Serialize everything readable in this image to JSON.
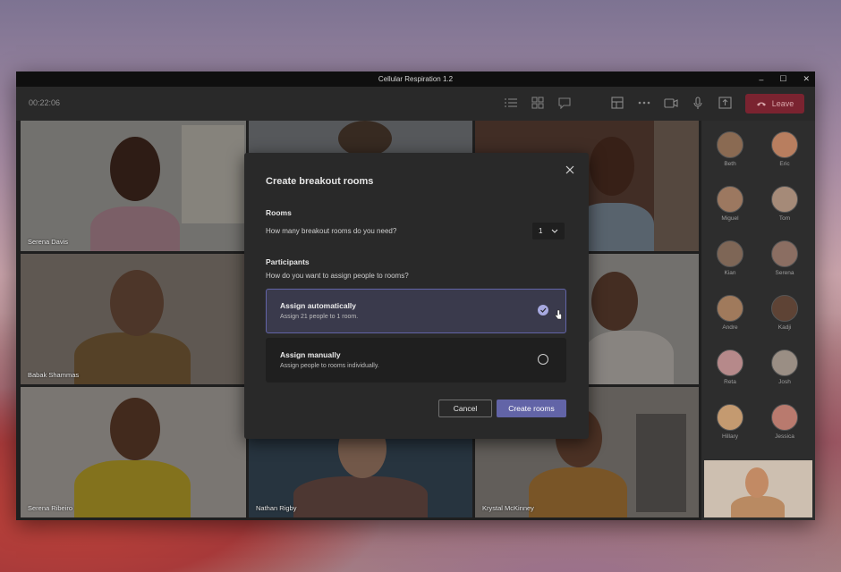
{
  "window": {
    "title": "Cellular Respiration 1.2",
    "controls": [
      "–",
      "☐",
      "✕"
    ]
  },
  "toolbar": {
    "timer": "00:22:06",
    "leave_label": "Leave"
  },
  "tiles": [
    {
      "name": "Serena Davis"
    },
    {
      "name": ""
    },
    {
      "name": ""
    },
    {
      "name": "Babak Shammas"
    },
    {
      "name": ""
    },
    {
      "name": "Serena Ribeiro"
    },
    {
      "name": "Nathan Rigby"
    },
    {
      "name": "Krystal McKinney"
    }
  ],
  "roster": [
    {
      "name": "Beth"
    },
    {
      "name": "Eric"
    },
    {
      "name": "Miguel"
    },
    {
      "name": "Tom"
    },
    {
      "name": "Kian"
    },
    {
      "name": "Serena"
    },
    {
      "name": "Andre"
    },
    {
      "name": "Kadji"
    },
    {
      "name": "Reta"
    },
    {
      "name": "Josh"
    },
    {
      "name": "Hillary"
    },
    {
      "name": "Jessica"
    }
  ],
  "modal": {
    "title": "Create breakout rooms",
    "rooms_heading": "Rooms",
    "rooms_question": "How many breakout rooms do you need?",
    "rooms_value": "1",
    "participants_heading": "Participants",
    "participants_question": "How do you want to assign people to rooms?",
    "option_auto": {
      "title": "Assign automatically",
      "desc": "Assign 21 people to 1 room.",
      "selected": true
    },
    "option_manual": {
      "title": "Assign manually",
      "desc": "Assign people to rooms individually.",
      "selected": false
    },
    "cancel_label": "Cancel",
    "create_label": "Create rooms"
  },
  "colors": {
    "accent": "#6264a7",
    "leave": "#7a2330",
    "window_bg": "#1f1f1f",
    "dialog_bg": "#292929"
  }
}
